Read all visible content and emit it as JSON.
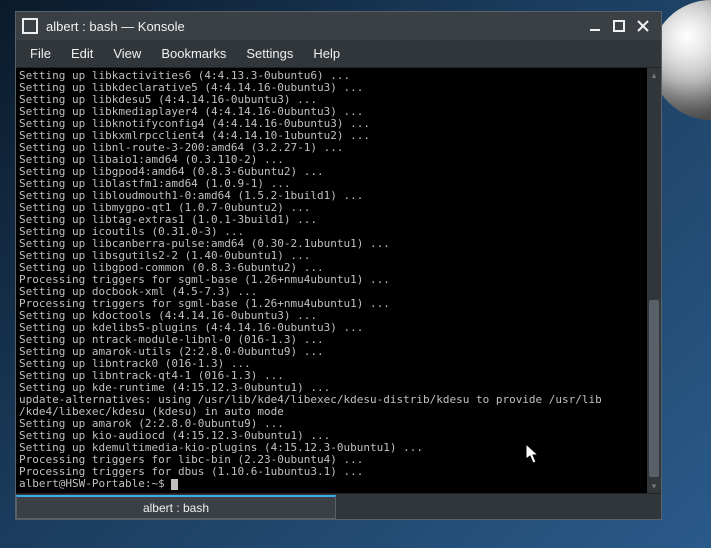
{
  "window": {
    "title": "albert : bash — Konsole"
  },
  "menu": {
    "file": "File",
    "edit": "Edit",
    "view": "View",
    "bookmarks": "Bookmarks",
    "settings": "Settings",
    "help": "Help"
  },
  "terminal": {
    "lines": [
      "Setting up libkactivities6 (4:4.13.3-0ubuntu6) ...",
      "Setting up libkdeclarative5 (4:4.14.16-0ubuntu3) ...",
      "Setting up libkdesu5 (4:4.14.16-0ubuntu3) ...",
      "Setting up libkmediaplayer4 (4:4.14.16-0ubuntu3) ...",
      "Setting up libknotifyconfig4 (4:4.14.16-0ubuntu3) ...",
      "Setting up libkxmlrpcclient4 (4:4.14.10-1ubuntu2) ...",
      "Setting up libnl-route-3-200:amd64 (3.2.27-1) ...",
      "Setting up libaio1:amd64 (0.3.110-2) ...",
      "Setting up libgpod4:amd64 (0.8.3-6ubuntu2) ...",
      "Setting up liblastfm1:amd64 (1.0.9-1) ...",
      "Setting up libloudmouth1-0:amd64 (1.5.2-1build1) ...",
      "Setting up libmygpo-qt1 (1.0.7-0ubuntu2) ...",
      "Setting up libtag-extras1 (1.0.1-3build1) ...",
      "Setting up icoutils (0.31.0-3) ...",
      "Setting up libcanberra-pulse:amd64 (0.30-2.1ubuntu1) ...",
      "Setting up libsgutils2-2 (1.40-0ubuntu1) ...",
      "Setting up libgpod-common (0.8.3-6ubuntu2) ...",
      "Processing triggers for sgml-base (1.26+nmu4ubuntu1) ...",
      "Setting up docbook-xml (4.5-7.3) ...",
      "Processing triggers for sgml-base (1.26+nmu4ubuntu1) ...",
      "Setting up kdoctools (4:4.14.16-0ubuntu3) ...",
      "Setting up kdelibs5-plugins (4:4.14.16-0ubuntu3) ...",
      "Setting up ntrack-module-libnl-0 (016-1.3) ...",
      "Setting up amarok-utils (2:2.8.0-0ubuntu9) ...",
      "Setting up libntrack0 (016-1.3) ...",
      "Setting up libntrack-qt4-1 (016-1.3) ...",
      "Setting up kde-runtime (4:15.12.3-0ubuntu1) ...",
      "update-alternatives: using /usr/lib/kde4/libexec/kdesu-distrib/kdesu to provide /usr/lib",
      "/kde4/libexec/kdesu (kdesu) in auto mode",
      "Setting up amarok (2:2.8.0-0ubuntu9) ...",
      "Setting up kio-audiocd (4:15.12.3-0ubuntu1) ...",
      "Setting up kdemultimedia-kio-plugins (4:15.12.3-0ubuntu1) ...",
      "Processing triggers for libc-bin (2.23-0ubuntu4) ...",
      "Processing triggers for dbus (1.10.6-1ubuntu3.1) ..."
    ],
    "prompt": "albert@HSW-Portable:~$ "
  },
  "tab": {
    "label": "albert : bash"
  }
}
